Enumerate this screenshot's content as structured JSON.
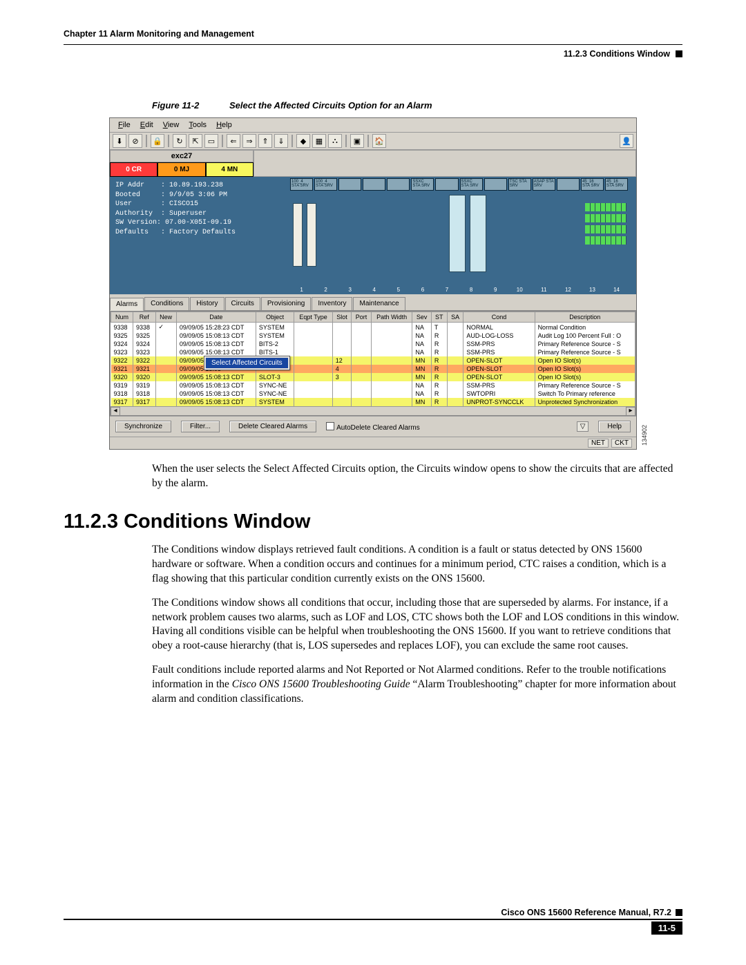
{
  "header": {
    "left": "Chapter 11 Alarm Monitoring and Management",
    "subsection": "11.2.3  Conditions Window"
  },
  "figure": {
    "label": "Figure 11-2",
    "title": "Select the Affected Circuits Option for an Alarm",
    "side_id": "134902"
  },
  "app": {
    "menu": [
      "File",
      "Edit",
      "View",
      "Tools",
      "Help"
    ],
    "toolbar_icons": [
      "↓",
      "⊘",
      "🔒",
      "↻",
      "⇧",
      "✎",
      "⇐",
      "⇒",
      "⇑",
      "⇓",
      "◆",
      "▦",
      "⛬",
      "▣",
      "🏠"
    ],
    "summary": {
      "title": "exc27",
      "cr": "0 CR",
      "mj": "0 MJ",
      "mn": "4 MN"
    },
    "node_info": {
      "ip_addr_label": "IP Addr",
      "ip_addr": "10.89.193.238",
      "booted_label": "Booted",
      "booted": "9/9/05 3:06 PM",
      "user_label": "User",
      "user": "CISCO15",
      "authority_label": "Authority",
      "authority": "Superuser",
      "swver_label": "SW Version",
      "swver": "07.00-X05I-09.19",
      "defaults_label": "Defaults",
      "defaults": "Factory Defaults"
    },
    "shelf_slot_headers": [
      "100_4\nSTA\nSRV",
      "100_4\nSTA\nSRV",
      "",
      "",
      "",
      "SSXC\nSTA\nSRV",
      "",
      "SSXC\nSTA\nSRV",
      "",
      "TSC\nSTA\nSRV",
      "ASAP\nSTA\nSRV",
      "",
      "45_16\nSTA\nSRV",
      "45_16\nSTA\nSRV"
    ],
    "slot_numbers": [
      "1",
      "2",
      "3",
      "4",
      "5",
      "6",
      "7",
      "8",
      "9",
      "10",
      "11",
      "12",
      "13",
      "14"
    ],
    "tabs": [
      "Alarms",
      "Conditions",
      "History",
      "Circuits",
      "Provisioning",
      "Inventory",
      "Maintenance"
    ],
    "active_tab": 0,
    "context_menu": "Select Affected Circuits",
    "table_headers": [
      "Num",
      "Ref",
      "New",
      "Date",
      "Object",
      "Eqpt Type",
      "Slot",
      "Port",
      "Path Width",
      "Sev",
      "ST",
      "SA",
      "Cond",
      "Description"
    ],
    "rows": [
      {
        "num": "9338",
        "ref": "9338",
        "new": "✓",
        "date": "09/09/05 15:28:23 CDT",
        "obj": "SYSTEM",
        "eqpt": "",
        "slot": "",
        "port": "",
        "pw": "",
        "sev": "NA",
        "st": "T",
        "sa": "",
        "cond": "NORMAL",
        "desc": "Normal Condition",
        "hi": false
      },
      {
        "num": "9325",
        "ref": "9325",
        "new": "",
        "date": "09/09/05 15:08:13 CDT",
        "obj": "SYSTEM",
        "eqpt": "",
        "slot": "",
        "port": "",
        "pw": "",
        "sev": "NA",
        "st": "R",
        "sa": "",
        "cond": "AUD-LOG-LOSS",
        "desc": "Audit Log 100 Percent Full : O",
        "hi": false
      },
      {
        "num": "9324",
        "ref": "9324",
        "new": "",
        "date": "09/09/05 15:08:13 CDT",
        "obj": "BITS-2",
        "eqpt": "",
        "slot": "",
        "port": "",
        "pw": "",
        "sev": "NA",
        "st": "R",
        "sa": "",
        "cond": "SSM-PRS",
        "desc": "Primary Reference Source - S",
        "hi": false
      },
      {
        "num": "9323",
        "ref": "9323",
        "new": "",
        "date": "09/09/05 15:08:13 CDT",
        "obj": "BITS-1",
        "eqpt": "",
        "slot": "",
        "port": "",
        "pw": "",
        "sev": "NA",
        "st": "R",
        "sa": "",
        "cond": "SSM-PRS",
        "desc": "Primary Reference Source - S",
        "hi": false
      },
      {
        "num": "9322",
        "ref": "9322",
        "new": "",
        "date": "09/09/05 15:08",
        "obj": "",
        "eqpt": "",
        "slot": "12",
        "port": "",
        "pw": "",
        "sev": "MN",
        "st": "R",
        "sa": "",
        "cond": "OPEN-SLOT",
        "desc": "Open IO Slot(s)",
        "hi": false
      },
      {
        "num": "9321",
        "ref": "9321",
        "new": "",
        "date": "09/09/05 15:08",
        "obj": "",
        "eqpt": "",
        "slot": "4",
        "port": "",
        "pw": "",
        "sev": "MN",
        "st": "R",
        "sa": "",
        "cond": "OPEN-SLOT",
        "desc": "Open IO Slot(s)",
        "hi": true
      },
      {
        "num": "9320",
        "ref": "9320",
        "new": "",
        "date": "09/09/05 15:08:13 CDT",
        "obj": "SLOT-3",
        "eqpt": "",
        "slot": "3",
        "port": "",
        "pw": "",
        "sev": "MN",
        "st": "R",
        "sa": "",
        "cond": "OPEN-SLOT",
        "desc": "Open IO Slot(s)",
        "hi": false
      },
      {
        "num": "9319",
        "ref": "9319",
        "new": "",
        "date": "09/09/05 15:08:13 CDT",
        "obj": "SYNC-NE",
        "eqpt": "",
        "slot": "",
        "port": "",
        "pw": "",
        "sev": "NA",
        "st": "R",
        "sa": "",
        "cond": "SSM-PRS",
        "desc": "Primary Reference Source - S",
        "hi": false
      },
      {
        "num": "9318",
        "ref": "9318",
        "new": "",
        "date": "09/09/05 15:08:13 CDT",
        "obj": "SYNC-NE",
        "eqpt": "",
        "slot": "",
        "port": "",
        "pw": "",
        "sev": "NA",
        "st": "R",
        "sa": "",
        "cond": "SWTOPRI",
        "desc": "Switch To Primary reference",
        "hi": false
      },
      {
        "num": "9317",
        "ref": "9317",
        "new": "",
        "date": "09/09/05 15:08:13 CDT",
        "obj": "SYSTEM",
        "eqpt": "",
        "slot": "",
        "port": "",
        "pw": "",
        "sev": "MN",
        "st": "R",
        "sa": "",
        "cond": "UNPROT-SYNCCLK",
        "desc": "Unprotected Synchronization",
        "hi": false
      }
    ],
    "buttons": {
      "sync": "Synchronize",
      "filter": "Filter...",
      "delete": "Delete Cleared Alarms",
      "autodelete": "AutoDelete Cleared Alarms",
      "help": "Help"
    },
    "status": {
      "net": "NET",
      "ckt": "CKT"
    }
  },
  "text": {
    "after_figure": "When the user selects the Select Affected Circuits option, the Circuits window opens to show the circuits that are affected by the alarm.",
    "heading": "11.2.3  Conditions Window",
    "p1": "The Conditions window displays retrieved fault conditions. A condition is a fault or status detected by ONS 15600 hardware or software. When a condition occurs and continues for a minimum period, CTC raises a condition, which is a flag showing that this particular condition currently exists on the ONS 15600.",
    "p2": "The Conditions window shows all conditions that occur, including those that are superseded by alarms. For instance, if a network problem causes two alarms, such as LOF and LOS, CTC shows both the LOF and LOS conditions in this window. Having all conditions visible can be helpful when troubleshooting the ONS 15600. If you want to retrieve conditions that obey a root-cause hierarchy (that is, LOS supersedes and replaces LOF), you can exclude the same root causes.",
    "p3a": "Fault conditions include reported alarms and Not Reported or Not Alarmed conditions. Refer to the trouble notifications information in the ",
    "p3i": "Cisco ONS 15600 Troubleshooting Guide ",
    "p3b": "“Alarm Troubleshooting” chapter for more information about alarm and condition classifications."
  },
  "footer": {
    "doc": "Cisco ONS 15600 Reference Manual, R7.2",
    "page": "11-5"
  }
}
